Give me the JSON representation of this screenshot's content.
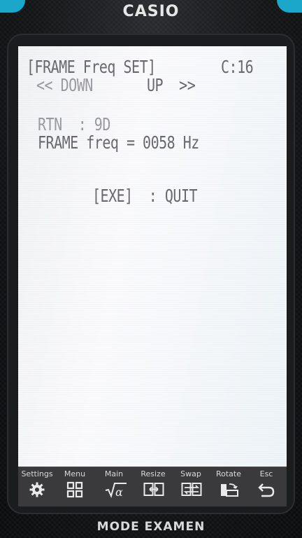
{
  "device": {
    "brand": "CASIO",
    "mode_label": "MODE EXAMEN"
  },
  "screen": {
    "title": "[FRAME Freq SET]",
    "counter": "C:16",
    "nav_down": "<< DOWN",
    "nav_up": "UP  >>",
    "rtn_line": "RTN  : 9D",
    "freq_line": "FRAME freq = 0058 Hz",
    "quit_line": "[EXE]  : QUIT"
  },
  "softkeys": [
    {
      "label": "Settings",
      "icon": "gear-icon"
    },
    {
      "label": "Menu",
      "icon": "grid-icon"
    },
    {
      "label": "Main",
      "icon": "sqrt-alpha-icon"
    },
    {
      "label": "Resize",
      "icon": "resize-icon"
    },
    {
      "label": "Swap",
      "icon": "swap-icon"
    },
    {
      "label": "Rotate",
      "icon": "rotate-icon"
    },
    {
      "label": "Esc",
      "icon": "return-icon"
    }
  ],
  "colors": {
    "accent": "#1aa7c9",
    "lcd_text": "#6a6a6e",
    "softbar": "#3a3a3d"
  }
}
